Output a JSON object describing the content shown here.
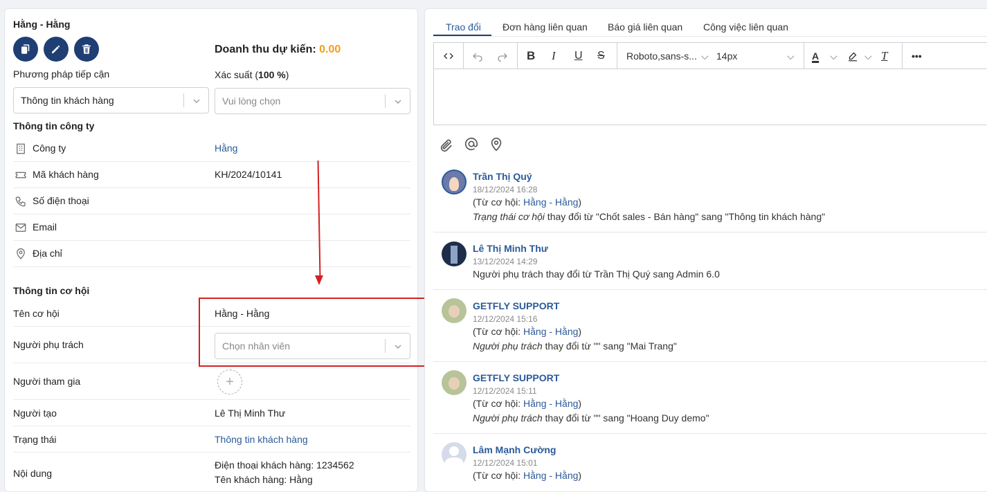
{
  "left": {
    "title": "Hằng - Hằng",
    "revenue_label": "Doanh thu dự kiến:",
    "revenue_value": "0.00",
    "approach_label": "Phương pháp tiếp cận",
    "approach_value": "Thông tin khách hàng",
    "probability_label": "Xác suất (",
    "probability_value": "100 %",
    "probability_close": ")",
    "probability_placeholder": "Vui lòng chọn",
    "company_section": "Thông tin công ty",
    "company_rows": [
      {
        "label": "Công ty",
        "value": "Hằng",
        "icon": "building-icon"
      },
      {
        "label": "Mã khách hàng",
        "value": "KH/2024/10141",
        "icon": "ticket-icon"
      },
      {
        "label": "Số điện thoại",
        "value": "",
        "icon": "phone-icon"
      },
      {
        "label": "Email",
        "value": "",
        "icon": "mail-icon"
      },
      {
        "label": "Địa chỉ",
        "value": "",
        "icon": "location-icon"
      }
    ],
    "opportunity_section": "Thông tin cơ hội",
    "opp_name_label": "Tên cơ hội",
    "opp_name_value": "Hằng - Hằng",
    "owner_label": "Người phụ trách",
    "owner_placeholder": "Chọn nhân viên",
    "participants_label": "Người tham gia",
    "creator_label": "Người tạo",
    "creator_value": "Lê Thị Minh Thư",
    "status_label": "Trạng thái",
    "status_value": "Thông tin khách hàng",
    "content_label": "Nội dung",
    "content_line1": "Điện thoại khách hàng: 1234562",
    "content_line2": "Tên khách hàng: Hằng"
  },
  "right": {
    "tabs": [
      "Trao đổi",
      "Đơn hàng liên quan",
      "Báo giá liên quan",
      "Công việc liên quan"
    ],
    "toolbar": {
      "font": "Roboto,sans-s...",
      "size": "14px"
    },
    "feed": [
      {
        "name": "Trần Thị Quý",
        "time": "18/12/2024 16:28",
        "line1_prefix": "(Từ cơ hội: ",
        "line1_link": "Hằng - Hằng",
        "line1_suffix": ")",
        "line2_italic": "Trạng thái cơ hội",
        "line2_rest": " thay đổi từ \"Chốt sales - Bán hàng\" sang \"Thông tin khách hàng\""
      },
      {
        "name": "Lê Thị Minh Thư",
        "time": "13/12/2024 14:29",
        "line1_text": "Người phụ trách thay đổi từ Trần Thị Quý sang Admin 6.0"
      },
      {
        "name": "GETFLY SUPPORT",
        "time": "12/12/2024 15:16",
        "line1_prefix": "(Từ cơ hội: ",
        "line1_link": "Hằng - Hằng",
        "line1_suffix": ")",
        "line2_italic": "Người phụ trách",
        "line2_rest": " thay đổi từ \"\" sang \"Mai Trang\""
      },
      {
        "name": "GETFLY SUPPORT",
        "time": "12/12/2024 15:11",
        "line1_prefix": "(Từ cơ hội: ",
        "line1_link": "Hằng - Hằng",
        "line1_suffix": ")",
        "line2_italic": "Người phụ trách",
        "line2_rest": " thay đổi từ \"\" sang \"Hoang Duy demo\""
      },
      {
        "name": "Lâm Mạnh Cường",
        "time": "12/12/2024 15:01",
        "line1_prefix": "(Từ cơ hội: ",
        "line1_link": "Hằng - Hằng",
        "line1_suffix": ")"
      }
    ]
  }
}
